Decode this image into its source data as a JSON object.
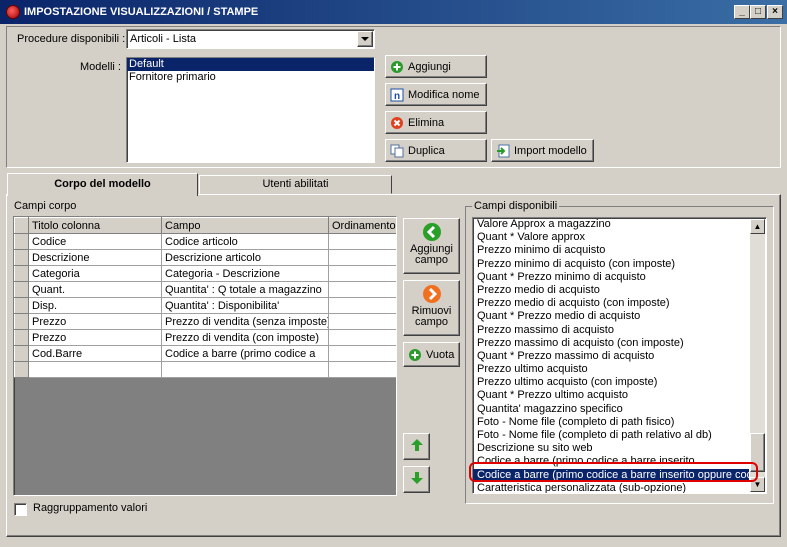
{
  "window": {
    "title": "IMPOSTAZIONE VISUALIZZAZIONI / STAMPE"
  },
  "procedure": {
    "label": "Procedure disponibili :",
    "value": "Articoli - Lista"
  },
  "modelli": {
    "label": "Modelli :",
    "items": [
      "Default",
      "Fornitore primario"
    ]
  },
  "buttons": {
    "aggiungi": "Aggiungi",
    "modifica": "Modifica nome",
    "elimina": "Elimina",
    "duplica": "Duplica",
    "import": "Import modello",
    "aggiungi_campo": "Aggiungi campo",
    "rimuovi_campo": "Rimuovi campo",
    "vuota": "Vuota"
  },
  "tabs": [
    "Corpo del modello",
    "Utenti abilitati"
  ],
  "campi_corpo": {
    "label": "Campi corpo",
    "headers": [
      "Titolo colonna",
      "Campo",
      "Ordinamento"
    ],
    "rows": [
      [
        "Codice",
        "Codice articolo",
        ""
      ],
      [
        "Descrizione",
        "Descrizione articolo",
        ""
      ],
      [
        "Categoria",
        "Categoria - Descrizione",
        ""
      ],
      [
        "Quant.",
        "Quantita' : Q totale a magazzino",
        ""
      ],
      [
        "Disp.",
        "Quantita' : Disponibilita'",
        ""
      ],
      [
        "Prezzo",
        "Prezzo di vendita (senza imposte)",
        ""
      ],
      [
        "Prezzo",
        "Prezzo di vendita (con imposte)",
        ""
      ],
      [
        "Cod.Barre",
        "Codice a barre (primo codice a",
        ""
      ],
      [
        "",
        "",
        ""
      ]
    ]
  },
  "campi_disponibili": {
    "label": "Campi disponibili",
    "items": [
      "Valore Approx a magazzino",
      "Quant * Valore approx",
      "Prezzo minimo di acquisto",
      "Prezzo minimo di acquisto (con imposte)",
      "Quant * Prezzo minimo di acquisto",
      "Prezzo medio di acquisto",
      "Prezzo medio di acquisto (con imposte)",
      "Quant * Prezzo medio di acquisto",
      "Prezzo massimo di acquisto",
      "Prezzo massimo di acquisto (con imposte)",
      "Quant * Prezzo massimo di acquisto",
      "Prezzo ultimo acquisto",
      "Prezzo ultimo acquisto (con imposte)",
      "Quant * Prezzo ultimo acquisto",
      "Quantita' magazzino specifico",
      "Foto - Nome file (completo di path fisico)",
      "Foto - Nome file (completo di path relativo al db)",
      "Descrizione su sito web",
      "Codice a barre (primo codice a barre inserito",
      "Codice a barre (primo codice a barre inserito oppure codice",
      "Caratteristica personalizzata (sub-opzione)"
    ],
    "selected_index": 19
  },
  "raggruppamento": {
    "label": "Raggruppamento valori",
    "checked": false
  },
  "colors": {
    "title_start": "#0a246a",
    "title_end": "#3a6ea5",
    "highlight": "#e00000"
  }
}
